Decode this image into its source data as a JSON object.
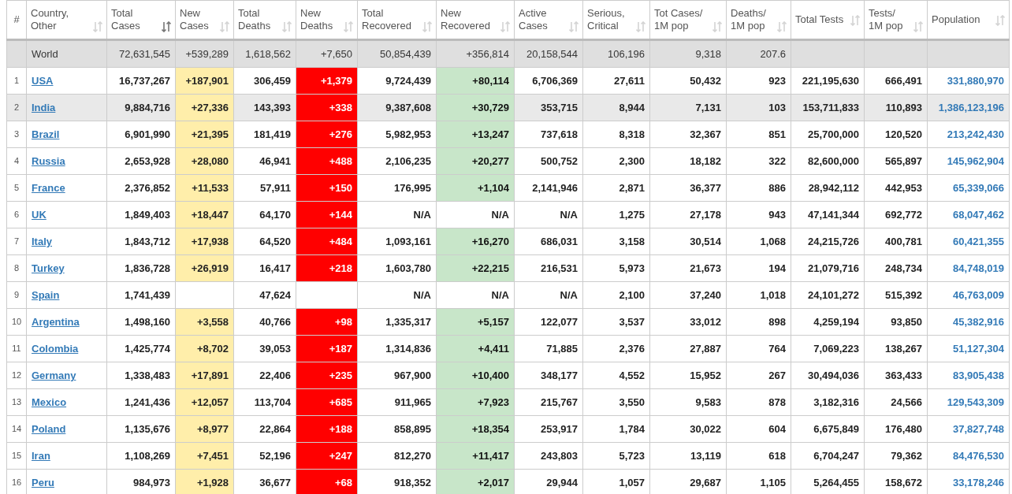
{
  "columns": [
    {
      "label": "#",
      "kind": "index"
    },
    {
      "label": "Country, Other",
      "kind": "country",
      "sorted": false
    },
    {
      "label": "Total Cases",
      "kind": "plain",
      "sorted": true
    },
    {
      "label": "New Cases",
      "kind": "new_cases",
      "sorted": false
    },
    {
      "label": "Total Deaths",
      "kind": "plain",
      "sorted": false
    },
    {
      "label": "New Deaths",
      "kind": "new_deaths",
      "sorted": false
    },
    {
      "label": "Total Recovered",
      "kind": "plain",
      "sorted": false
    },
    {
      "label": "New Recovered",
      "kind": "new_recovered",
      "sorted": false
    },
    {
      "label": "Active Cases",
      "kind": "plain",
      "sorted": false
    },
    {
      "label": "Serious, Critical",
      "kind": "plain",
      "sorted": false
    },
    {
      "label": "Tot Cases/ 1M pop",
      "kind": "plain",
      "sorted": false
    },
    {
      "label": "Deaths/ 1M pop",
      "kind": "plain",
      "sorted": false
    },
    {
      "label": "Total Tests",
      "kind": "plain",
      "sorted": false
    },
    {
      "label": "Tests/ 1M pop",
      "kind": "plain",
      "sorted": false
    },
    {
      "label": "Population",
      "kind": "population",
      "sorted": false
    }
  ],
  "world": {
    "label": "World",
    "cells": [
      "72,631,545",
      "+539,289",
      "1,618,562",
      "+7,650",
      "50,854,439",
      "+356,814",
      "20,158,544",
      "106,196",
      "9,318",
      "207.6",
      null,
      null,
      null
    ]
  },
  "rows": [
    {
      "index": "1",
      "country": "USA",
      "highlighted": false,
      "cells": [
        "16,737,267",
        {
          "value": "+187,901",
          "highlight": true
        },
        "306,459",
        {
          "value": "+1,379",
          "highlight": true
        },
        "9,724,439",
        {
          "value": "+80,114",
          "highlight": true
        },
        "6,706,369",
        "27,611",
        "50,432",
        "923",
        "221,195,630",
        "666,491",
        "331,880,970"
      ]
    },
    {
      "index": "2",
      "country": "India",
      "highlighted": true,
      "cells": [
        "9,884,716",
        {
          "value": "+27,336",
          "highlight": true
        },
        "143,393",
        {
          "value": "+338",
          "highlight": true
        },
        "9,387,608",
        {
          "value": "+30,729",
          "highlight": true
        },
        "353,715",
        "8,944",
        "7,131",
        "103",
        "153,711,833",
        "110,893",
        "1,386,123,196"
      ]
    },
    {
      "index": "3",
      "country": "Brazil",
      "highlighted": false,
      "cells": [
        "6,901,990",
        {
          "value": "+21,395",
          "highlight": true
        },
        "181,419",
        {
          "value": "+276",
          "highlight": true
        },
        "5,982,953",
        {
          "value": "+13,247",
          "highlight": true
        },
        "737,618",
        "8,318",
        "32,367",
        "851",
        "25,700,000",
        "120,520",
        "213,242,430"
      ]
    },
    {
      "index": "4",
      "country": "Russia",
      "highlighted": false,
      "cells": [
        "2,653,928",
        {
          "value": "+28,080",
          "highlight": true
        },
        "46,941",
        {
          "value": "+488",
          "highlight": true
        },
        "2,106,235",
        {
          "value": "+20,277",
          "highlight": true
        },
        "500,752",
        "2,300",
        "18,182",
        "322",
        "82,600,000",
        "565,897",
        "145,962,904"
      ]
    },
    {
      "index": "5",
      "country": "France",
      "highlighted": false,
      "cells": [
        "2,376,852",
        {
          "value": "+11,533",
          "highlight": true
        },
        "57,911",
        {
          "value": "+150",
          "highlight": true
        },
        "176,995",
        {
          "value": "+1,104",
          "highlight": true
        },
        "2,141,946",
        "2,871",
        "36,377",
        "886",
        "28,942,112",
        "442,953",
        "65,339,066"
      ]
    },
    {
      "index": "6",
      "country": "UK",
      "highlighted": false,
      "cells": [
        "1,849,403",
        {
          "value": "+18,447",
          "highlight": true
        },
        "64,170",
        {
          "value": "+144",
          "highlight": true
        },
        "N/A",
        "N/A",
        "N/A",
        "1,275",
        "27,178",
        "943",
        "47,141,344",
        "692,772",
        "68,047,462"
      ]
    },
    {
      "index": "7",
      "country": "Italy",
      "highlighted": false,
      "cells": [
        "1,843,712",
        {
          "value": "+17,938",
          "highlight": true
        },
        "64,520",
        {
          "value": "+484",
          "highlight": true
        },
        "1,093,161",
        {
          "value": "+16,270",
          "highlight": true
        },
        "686,031",
        "3,158",
        "30,514",
        "1,068",
        "24,215,726",
        "400,781",
        "60,421,355"
      ]
    },
    {
      "index": "8",
      "country": "Turkey",
      "highlighted": false,
      "cells": [
        "1,836,728",
        {
          "value": "+26,919",
          "highlight": true
        },
        "16,417",
        {
          "value": "+218",
          "highlight": true
        },
        "1,603,780",
        {
          "value": "+22,215",
          "highlight": true
        },
        "216,531",
        "5,973",
        "21,673",
        "194",
        "21,079,716",
        "248,734",
        "84,748,019"
      ]
    },
    {
      "index": "9",
      "country": "Spain",
      "highlighted": false,
      "cells": [
        "1,741,439",
        null,
        "47,624",
        null,
        "N/A",
        "N/A",
        "N/A",
        "2,100",
        "37,240",
        "1,018",
        "24,101,272",
        "515,392",
        "46,763,009"
      ]
    },
    {
      "index": "10",
      "country": "Argentina",
      "highlighted": false,
      "cells": [
        "1,498,160",
        {
          "value": "+3,558",
          "highlight": true
        },
        "40,766",
        {
          "value": "+98",
          "highlight": true
        },
        "1,335,317",
        {
          "value": "+5,157",
          "highlight": true
        },
        "122,077",
        "3,537",
        "33,012",
        "898",
        "4,259,194",
        "93,850",
        "45,382,916"
      ]
    },
    {
      "index": "11",
      "country": "Colombia",
      "highlighted": false,
      "cells": [
        "1,425,774",
        {
          "value": "+8,702",
          "highlight": true
        },
        "39,053",
        {
          "value": "+187",
          "highlight": true
        },
        "1,314,836",
        {
          "value": "+4,411",
          "highlight": true
        },
        "71,885",
        "2,376",
        "27,887",
        "764",
        "7,069,223",
        "138,267",
        "51,127,304"
      ]
    },
    {
      "index": "12",
      "country": "Germany",
      "highlighted": false,
      "cells": [
        "1,338,483",
        {
          "value": "+17,891",
          "highlight": true
        },
        "22,406",
        {
          "value": "+235",
          "highlight": true
        },
        "967,900",
        {
          "value": "+10,400",
          "highlight": true
        },
        "348,177",
        "4,552",
        "15,952",
        "267",
        "30,494,036",
        "363,433",
        "83,905,438"
      ]
    },
    {
      "index": "13",
      "country": "Mexico",
      "highlighted": false,
      "cells": [
        "1,241,436",
        {
          "value": "+12,057",
          "highlight": true
        },
        "113,704",
        {
          "value": "+685",
          "highlight": true
        },
        "911,965",
        {
          "value": "+7,923",
          "highlight": true
        },
        "215,767",
        "3,550",
        "9,583",
        "878",
        "3,182,316",
        "24,566",
        "129,543,309"
      ]
    },
    {
      "index": "14",
      "country": "Poland",
      "highlighted": false,
      "cells": [
        "1,135,676",
        {
          "value": "+8,977",
          "highlight": true
        },
        "22,864",
        {
          "value": "+188",
          "highlight": true
        },
        "858,895",
        {
          "value": "+18,354",
          "highlight": true
        },
        "253,917",
        "1,784",
        "30,022",
        "604",
        "6,675,849",
        "176,480",
        "37,827,748"
      ]
    },
    {
      "index": "15",
      "country": "Iran",
      "highlighted": false,
      "cells": [
        "1,108,269",
        {
          "value": "+7,451",
          "highlight": true
        },
        "52,196",
        {
          "value": "+247",
          "highlight": true
        },
        "812,270",
        {
          "value": "+11,417",
          "highlight": true
        },
        "243,803",
        "5,723",
        "13,119",
        "618",
        "6,704,247",
        "79,362",
        "84,476,530"
      ]
    },
    {
      "index": "16",
      "country": "Peru",
      "highlighted": false,
      "cells": [
        "984,973",
        {
          "value": "+1,928",
          "highlight": true
        },
        "36,677",
        {
          "value": "+68",
          "highlight": true
        },
        "918,352",
        {
          "value": "+2,017",
          "highlight": true
        },
        "29,944",
        "1,057",
        "29,687",
        "1,105",
        "5,264,455",
        "158,672",
        "33,178,246"
      ]
    }
  ]
}
